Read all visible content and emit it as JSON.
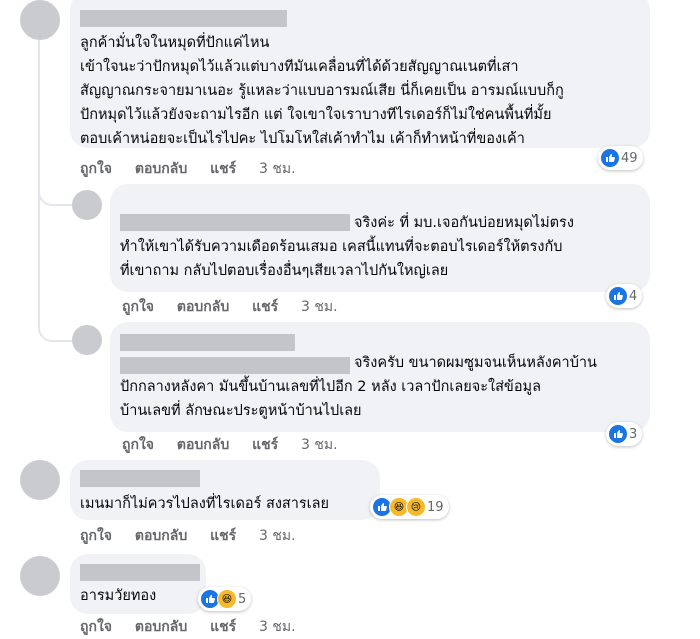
{
  "comment1": {
    "lines": [
      "ลูกค้ามั่นใจในหมุดที่ปักแค่ไหน",
      "เข้าใจนะว่าปักหมุดไว้แล้วแต่บางทีมันเคลื่อนที่ได้ด้วยสัญญาณเนตที่เสา",
      "สัญญาณกระจายมาเนอะ รู้แหละว่าแบบอารมณ์เสีย นี่ก็เคยเป็น อารมณ์แบบก็กู",
      "ปักหมุดไว้แล้วยังจะถามไรอีก แต่ ใจเขาใจเราบางทีไรเดอร์ก็ไม่ใช่คนพื้นที่มั้ย",
      "ตอบเค้าหน่อยจะเป็นไรไปคะ ไปโมโหใส่เค้าทำไม เค้าก็ทำหน้าที่ของเค้า"
    ],
    "reaction_count": "49",
    "time": "3 ชม."
  },
  "reply1": {
    "lines": [
      "จริงค่ะ ที่ มบ.เจอกันบ่อยหมุดไม่ตรง",
      "ทำให้เขาได้รับความเดือดร้อนเสมอ เคสนี้แทนที่จะตอบไรเดอร์ให้ตรงกับ",
      "ที่เขาถาม กลับไปตอบเรื่องอื่นๆเสียเวลาไปกันใหญ่เลย"
    ],
    "reaction_count": "4",
    "time": "3 ชม."
  },
  "reply2": {
    "lines": [
      "จริงครับ ขนาดผมซูมจนเห็นหลังคาบ้าน",
      "ปักกลางหลังคา มันขึ้นบ้านเลขที่ไปอีก 2 หลัง เวลาปักเลยจะใส่ข้อมูล",
      "บ้านเลขที่ ลักษณะประตูหน้าบ้านไปเลย"
    ],
    "reaction_count": "3",
    "time": "3 ชม."
  },
  "comment2": {
    "lines": [
      "เมนมาก็ไม่ควรไปลงที่ไรเดอร์ สงสารเลย"
    ],
    "reaction_count": "19",
    "time": "3 ชม."
  },
  "comment3": {
    "lines": [
      "อารมวัยทอง"
    ],
    "reaction_count": "5",
    "time": "3 ชม."
  },
  "labels": {
    "like": "ถูกใจ",
    "reply": "ตอบกลับ",
    "share": "แชร์"
  },
  "icons": {
    "like": "like-icon",
    "haha": "haha-icon",
    "sad": "sad-icon"
  },
  "colors": {
    "like_blue": "#1b74e4",
    "bubble": "#f0f2f5",
    "meta": "#65676b"
  }
}
